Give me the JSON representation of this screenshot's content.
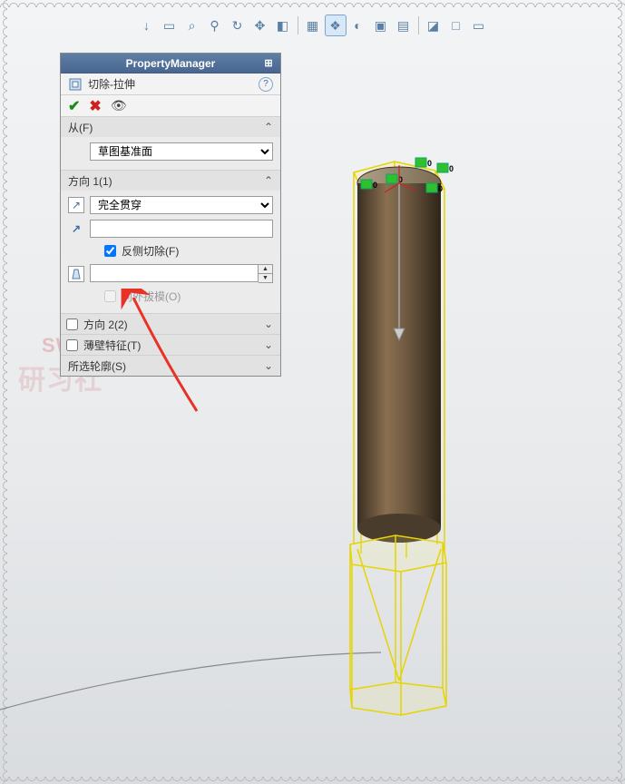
{
  "toolbar": {
    "icons": [
      "arrow-down-icon",
      "rect-select-icon",
      "zoom-fit-icon",
      "zoom-area-icon",
      "rotate-view-icon",
      "pan-icon",
      "display-style-icon",
      "section-icon",
      "scene-icon",
      "shadow-icon",
      "view-orient-icon",
      "hide-show-icon",
      "appearance-icon",
      "render-icon",
      "screen-icon"
    ],
    "glyphs": [
      "↓",
      "▭",
      "⌕",
      "⚲",
      "↻",
      "✥",
      "◧",
      "▦",
      "❖",
      "◐",
      "▣",
      "▤",
      "◪",
      "□",
      "▭"
    ]
  },
  "panel": {
    "title": "PropertyManager",
    "feature_name": "切除-拉伸",
    "sections": {
      "from": {
        "label": "从(F)",
        "select_value": "草图基准面"
      },
      "direction1": {
        "label": "方向 1(1)",
        "end_condition": "完全贯穿",
        "flip_side_label": "反侧切除(F)",
        "flip_side_checked": true,
        "draft_label": "向外拔模(O)",
        "draft_checked": false,
        "depth_value": ""
      },
      "direction2": {
        "label": "方向 2(2)"
      },
      "thin": {
        "label": "薄壁特征(T)"
      },
      "contours": {
        "label": "所选轮廓(S)"
      }
    }
  },
  "dimension_markers": [
    "0",
    "0",
    "0",
    "0",
    "0"
  ]
}
